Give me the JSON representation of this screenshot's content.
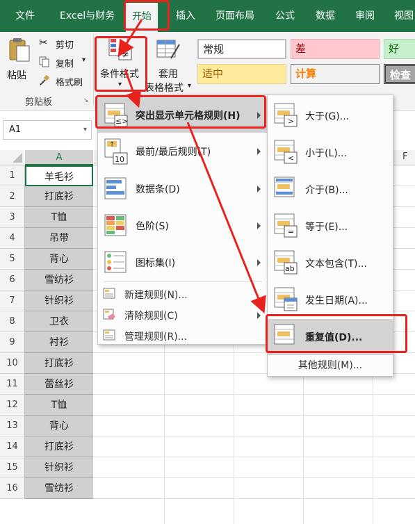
{
  "tabs": [
    "文件",
    "Excel与财务",
    "开始",
    "插入",
    "页面布局",
    "公式",
    "数据",
    "审阅",
    "视图"
  ],
  "active_tab": "开始",
  "clipboard": {
    "paste": "粘贴",
    "cut": "剪切",
    "copy": "复制",
    "format_painter": "格式刷",
    "group": "剪贴板"
  },
  "cond_format": {
    "line1": "条件格式",
    "arrow": "▾"
  },
  "table_format": {
    "line1": "套用",
    "line2": "表格格式",
    "arrow": "▾"
  },
  "styles": {
    "normal": "常规",
    "bad": "差",
    "good": "好",
    "neutral": "适中",
    "calc": "计算",
    "check": "检查"
  },
  "style_colors": {
    "bad_bg": "#ffc7ce",
    "bad_fg": "#9c0006",
    "good_bg": "#c6efce",
    "good_fg": "#006100",
    "neutral_bg": "#ffeb9c",
    "neutral_fg": "#9c5700",
    "calc_fg": "#fa7d00"
  },
  "name_box": "A1",
  "col_headers": [
    "A",
    "F"
  ],
  "rows": [
    {
      "n": "1",
      "v": "羊毛衫"
    },
    {
      "n": "2",
      "v": "打底衫"
    },
    {
      "n": "3",
      "v": "T恤"
    },
    {
      "n": "4",
      "v": "吊带"
    },
    {
      "n": "5",
      "v": "背心"
    },
    {
      "n": "6",
      "v": "雪纺衫"
    },
    {
      "n": "7",
      "v": "针织衫"
    },
    {
      "n": "8",
      "v": "卫衣"
    },
    {
      "n": "9",
      "v": "衬衫"
    },
    {
      "n": "10",
      "v": "打底衫"
    },
    {
      "n": "11",
      "v": "蕾丝衫"
    },
    {
      "n": "12",
      "v": "T恤"
    },
    {
      "n": "13",
      "v": "背心"
    },
    {
      "n": "14",
      "v": "打底衫"
    },
    {
      "n": "15",
      "v": "针织衫"
    },
    {
      "n": "16",
      "v": "雪纺衫"
    }
  ],
  "menu_main": [
    {
      "label": "突出显示单元格规则(H)",
      "icon": "highlight-rules-icon"
    },
    {
      "label": "最前/最后规则(T)",
      "icon": "top-bottom-icon"
    },
    {
      "label": "数据条(D)",
      "icon": "data-bars-icon"
    },
    {
      "label": "色阶(S)",
      "icon": "color-scales-icon"
    },
    {
      "label": "图标集(I)",
      "icon": "icon-sets-icon"
    }
  ],
  "menu_main_small": [
    {
      "label": "新建规则(N)...",
      "icon": "new-rule-icon"
    },
    {
      "label": "清除规则(C)",
      "icon": "clear-rules-icon"
    },
    {
      "label": "管理规则(R)...",
      "icon": "manage-rules-icon"
    }
  ],
  "menu_sub": [
    {
      "label": "大于(G)...",
      "icon": "greater-than-icon",
      "sym": ">"
    },
    {
      "label": "小于(L)...",
      "icon": "less-than-icon",
      "sym": "<"
    },
    {
      "label": "介于(B)...",
      "icon": "between-icon",
      "sym": ""
    },
    {
      "label": "等于(E)...",
      "icon": "equal-to-icon",
      "sym": "="
    },
    {
      "label": "文本包含(T)...",
      "icon": "text-contains-icon",
      "sym": "ab"
    },
    {
      "label": "发生日期(A)...",
      "icon": "date-occurring-icon",
      "sym": ""
    },
    {
      "label": "重复值(D)...",
      "icon": "duplicate-values-icon",
      "sym": ""
    }
  ],
  "menu_sub_more": "其他规则(M)...",
  "accent": "#217346",
  "annotation_color": "#e8231e"
}
